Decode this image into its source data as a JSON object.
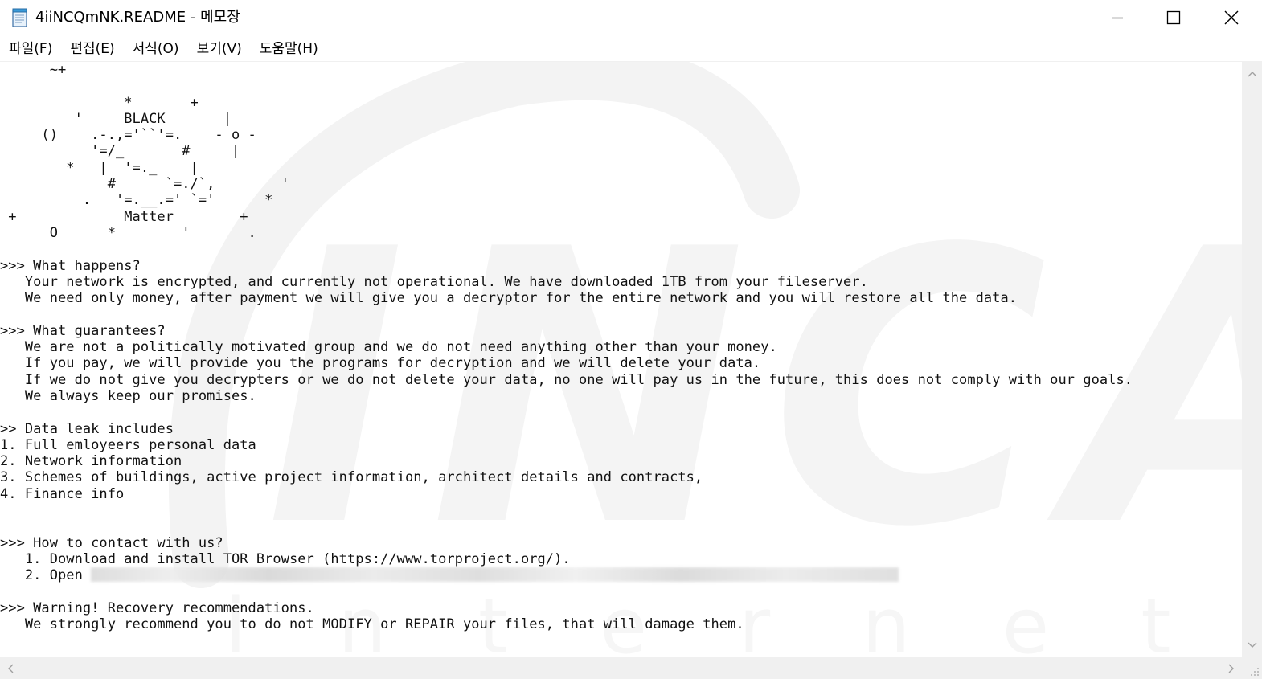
{
  "window": {
    "title": "4iiNCQmNK.README - 메모장",
    "icons": {
      "app": "notepad-icon",
      "minimize": "minimize-icon",
      "maximize": "maximize-icon",
      "close": "close-icon"
    }
  },
  "menu": {
    "items": [
      {
        "label": "파일(F)",
        "name": "menu-file"
      },
      {
        "label": "편집(E)",
        "name": "menu-edit"
      },
      {
        "label": "서식(O)",
        "name": "menu-format"
      },
      {
        "label": "보기(V)",
        "name": "menu-view"
      },
      {
        "label": "도움말(H)",
        "name": "menu-help"
      }
    ]
  },
  "document": {
    "art_lines": [
      "      ~+",
      "",
      "               *       +",
      "         '     BLACK       |",
      "     ()    .-.,='``'=.    - o -",
      "           '=/_       #     |",
      "        *   |  '=._    |",
      "             #      `=./`,        '",
      "          .   '=.__.=' `='      *",
      " +             Matter        +",
      "      O      *        '       ."
    ],
    "body_before_open": [
      "",
      ">>> What happens?",
      "   Your network is encrypted, and currently not operational. We have downloaded 1TB from your fileserver.",
      "   We need only money, after payment we will give you a decryptor for the entire network and you will restore all the data.",
      "",
      ">>> What guarantees?",
      "   We are not a politically motivated group and we do not need anything other than your money.",
      "   If you pay, we will provide you the programs for decryption and we will delete your data.",
      "   If we do not give you decrypters or we do not delete your data, no one will pay us in the future, this does not comply with our goals.",
      "   We always keep our promises.",
      "",
      ">> Data leak includes",
      "1. Full emloyeers personal data",
      "2. Network information",
      "3. Schemes of buildings, active project information, architect details and contracts,",
      "4. Finance info",
      "",
      "",
      ">>> How to contact with us?",
      "   1. Download and install TOR Browser (https://www.torproject.org/)."
    ],
    "open_line_prefix": "   2. Open ",
    "body_after_open": [
      "",
      ">>> Warning! Recovery recommendations.",
      "   We strongly recommend you to do not MODIFY or REPAIR your files, that will damage them."
    ]
  },
  "watermark": {
    "big_text": "INCA",
    "small_text": "i n t e r n e t"
  },
  "scrollbars": {
    "icons": {
      "up": "scroll-up-arrow-icon",
      "down": "scroll-down-arrow-icon",
      "left": "scroll-left-arrow-icon",
      "right": "scroll-right-arrow-icon",
      "grip": "size-grip-icon"
    }
  }
}
